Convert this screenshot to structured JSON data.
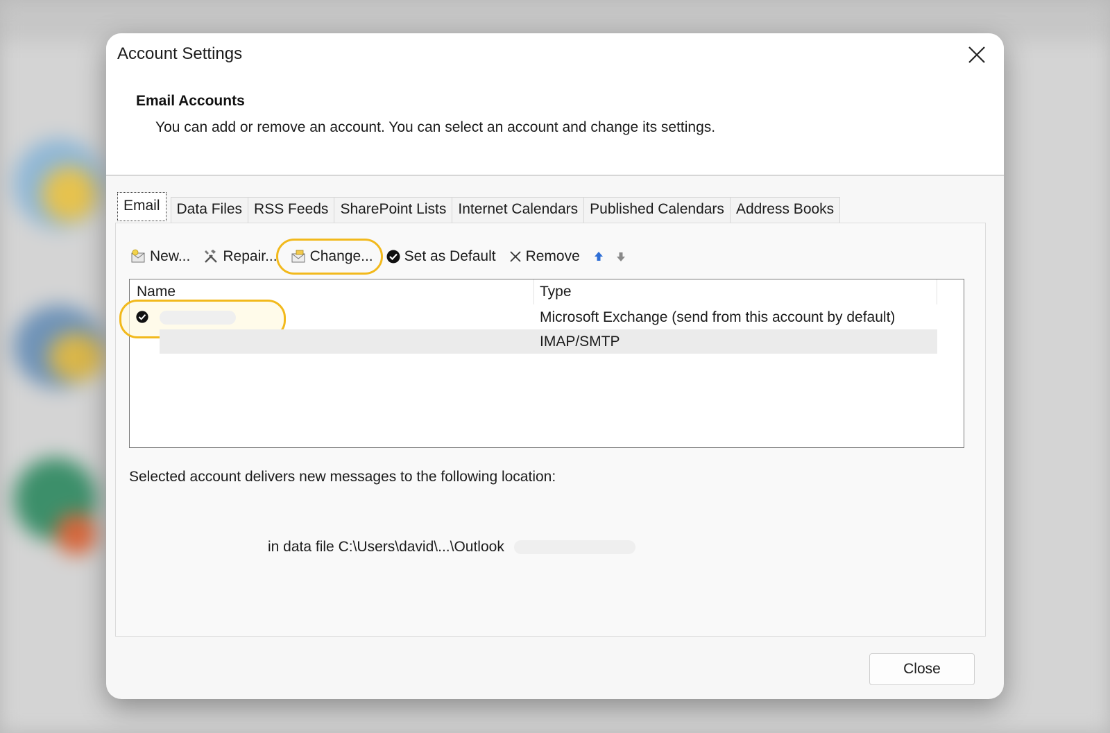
{
  "dialog": {
    "title": "Account Settings",
    "section_title": "Email Accounts",
    "section_description": "You can add or remove an account. You can select an account and change its settings."
  },
  "tabs": [
    {
      "label": "Email",
      "active": true
    },
    {
      "label": "Data Files",
      "active": false
    },
    {
      "label": "RSS Feeds",
      "active": false
    },
    {
      "label": "SharePoint Lists",
      "active": false
    },
    {
      "label": "Internet Calendars",
      "active": false
    },
    {
      "label": "Published Calendars",
      "active": false
    },
    {
      "label": "Address Books",
      "active": false
    }
  ],
  "toolbar": {
    "new_label": "New...",
    "repair_label": "Repair...",
    "change_label": "Change...",
    "set_default_label": "Set as Default",
    "remove_label": "Remove",
    "move_up_icon": "arrow-up-icon",
    "move_down_icon": "arrow-down-icon"
  },
  "account_list": {
    "columns": [
      "Name",
      "Type"
    ],
    "rows": [
      {
        "name": "",
        "type": "Microsoft Exchange (send from this account by default)",
        "default": true
      },
      {
        "name": "",
        "type": "IMAP/SMTP",
        "default": false
      }
    ]
  },
  "delivery": {
    "label": "Selected account delivers new messages to the following location:",
    "data_file": "in data file C:\\Users\\david\\...\\Outlook"
  },
  "footer": {
    "close_label": "Close"
  },
  "colors": {
    "highlight": "#f2b91c",
    "arrow_up": "#2f6fd6",
    "arrow_down": "#8a8a8a"
  }
}
